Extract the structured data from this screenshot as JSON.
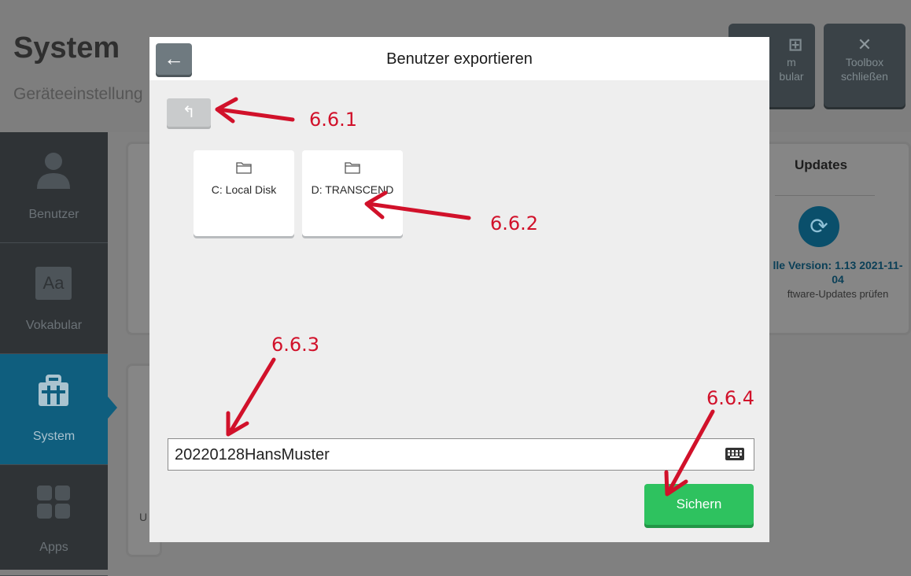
{
  "background": {
    "header": {
      "title": "System",
      "subtitle": "Geräteeinstellung"
    },
    "toolbar": [
      {
        "icon": "grid-icon",
        "line1": "m",
        "line2": "bular"
      },
      {
        "icon": "close-icon",
        "line1": "Toolbox",
        "line2": "schließen"
      }
    ],
    "sidebar": {
      "items": [
        {
          "label": "Benutzer",
          "icon": "user-icon",
          "active": false
        },
        {
          "label": "Vokabular",
          "icon": "text-aa-icon",
          "icon_text": "Aa",
          "active": false
        },
        {
          "label": "System",
          "icon": "toolbox-icon",
          "active": true
        },
        {
          "label": "Apps",
          "icon": "apps-grid-icon",
          "active": false
        }
      ]
    },
    "updates": {
      "title": "Updates",
      "icon": "refresh-icon",
      "version": "lle Version: 1.13 2021-11-04",
      "check": "ftware-Updates prüfen"
    },
    "panel_fragment": "U"
  },
  "dialog": {
    "title": "Benutzer exportieren",
    "back_icon": "back-arrow-icon",
    "up_icon": "folder-up-icon",
    "drives": [
      {
        "label": "C: Local Disk",
        "icon": "folder-icon"
      },
      {
        "label": "D: TRANSCEND",
        "icon": "folder-icon"
      }
    ],
    "filename_value": "20220128HansMuster",
    "keyboard_icon": "keyboard-icon",
    "save_label": "Sichern"
  },
  "annotations": [
    "6.6.1",
    "6.6.2",
    "6.6.3",
    "6.6.4"
  ],
  "colors": {
    "annotation": "#d1112a",
    "save_button": "#2ec25f",
    "active_sidebar": "#0f5e7e"
  }
}
